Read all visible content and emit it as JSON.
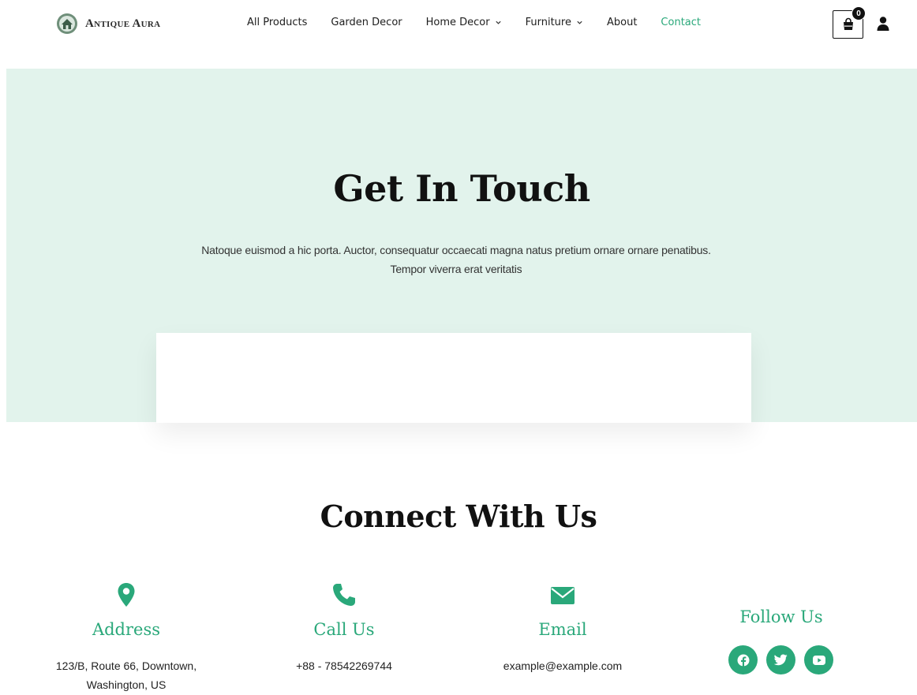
{
  "brand": {
    "name": "Antique Aura",
    "logo_icon": "antique-house-emblem"
  },
  "nav": {
    "items": [
      {
        "label": "All Products"
      },
      {
        "label": "Garden Decor"
      },
      {
        "label": "Home Decor",
        "dropdown": true
      },
      {
        "label": "Furniture",
        "dropdown": true
      },
      {
        "label": "About"
      },
      {
        "label": "Contact",
        "active": true
      }
    ]
  },
  "cart": {
    "count": "0",
    "icon": "shopping-bag-icon"
  },
  "account": {
    "icon": "user-icon"
  },
  "hero": {
    "title": "Get In Touch",
    "text_line1": "Natoque euismod a hic porta. Auctor, consequatur occaecati magna natus pretium ornare ornare penatibus.",
    "text_line2": "Tempor viverra erat veritatis"
  },
  "connect": {
    "title": "Connect With Us",
    "address": {
      "title": "Address",
      "line1": "123/B, Route 66, Downtown,",
      "line2": "Washington, US",
      "icon": "map-pin-icon"
    },
    "phone": {
      "title": "Call Us",
      "value": "+88 - 78542269744",
      "icon": "phone-icon"
    },
    "email": {
      "title": "Email",
      "value": "example@example.com",
      "icon": "envelope-icon"
    },
    "follow": {
      "title": "Follow Us",
      "networks": [
        "facebook",
        "twitter",
        "youtube"
      ]
    }
  },
  "colors": {
    "accent": "#2aa87a",
    "hero_bg": "#e2f3ec",
    "text": "#1a1a1a"
  }
}
